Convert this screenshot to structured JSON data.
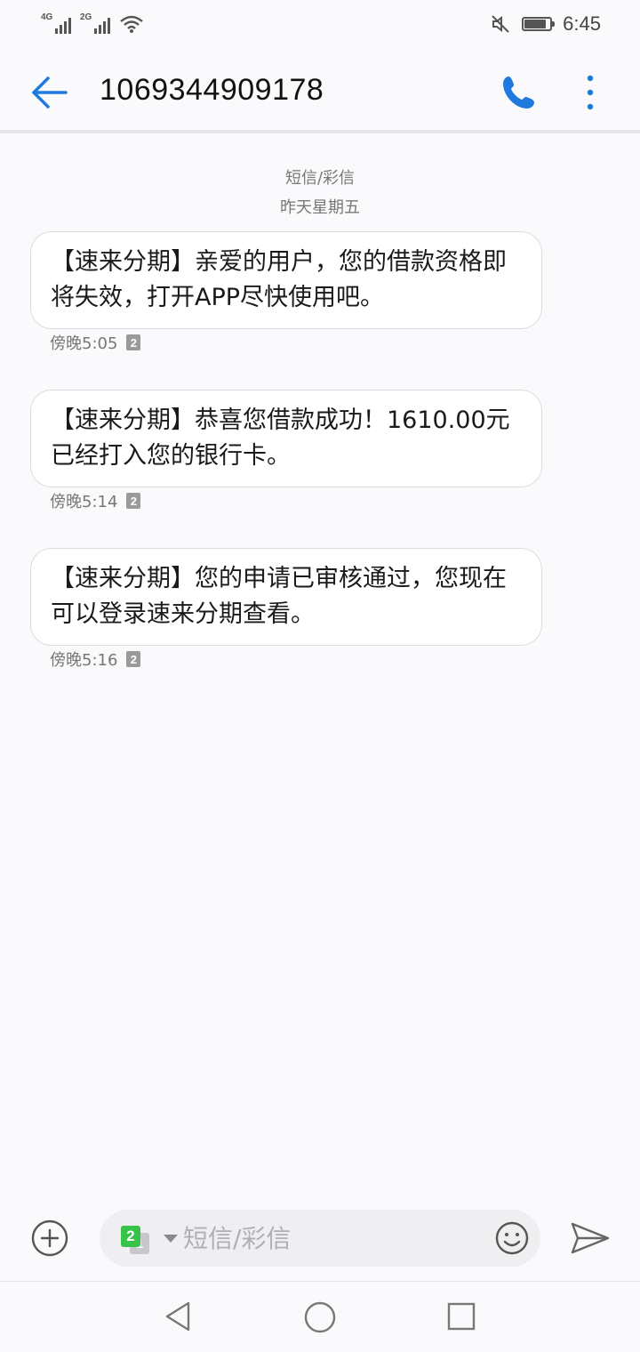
{
  "status_bar": {
    "sim1_label": "4G",
    "sim2_label": "2G",
    "time": "6:45",
    "battery_level": 0.85
  },
  "header": {
    "title": "1069344909178"
  },
  "conversation": {
    "date_header_line1": "短信/彩信",
    "date_header_line2": "昨天星期五",
    "messages": [
      {
        "text": "【速来分期】亲爱的用户，您的借款资格即将失效，打开APP尽快使用吧。",
        "time": "傍晚5:05",
        "sim": "2"
      },
      {
        "text": "【速来分期】恭喜您借款成功！1610.00元已经打入您的银行卡。",
        "time": "傍晚5:14",
        "sim": "2"
      },
      {
        "text": "【速来分期】您的申请已审核通过，您现在可以登录速来分期查看。",
        "time": "傍晚5:16",
        "sim": "2"
      }
    ]
  },
  "composer": {
    "placeholder": "短信/彩信",
    "sim_selected": "2",
    "sim_other": "1"
  },
  "colors": {
    "accent": "#1f7ae0",
    "sim_green": "#37c24a"
  }
}
